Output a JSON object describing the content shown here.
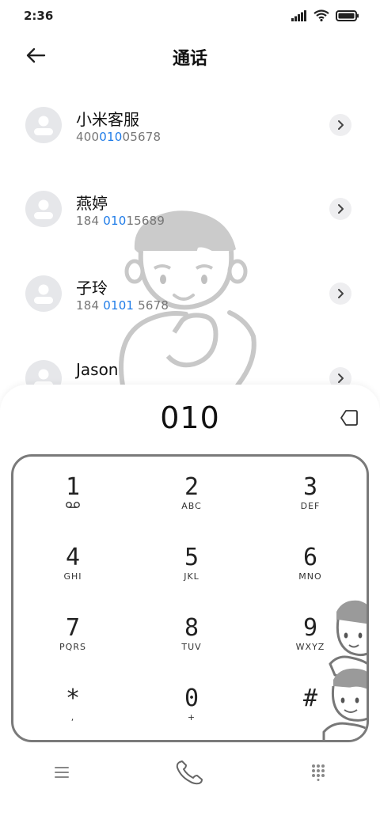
{
  "status_bar": {
    "time": "2:36"
  },
  "header": {
    "title": "通话"
  },
  "contacts": [
    {
      "name": "小米客服",
      "number_pre": "400",
      "number_hl": "010",
      "number_post": "05678"
    },
    {
      "name": "燕婷",
      "number_pre": "184 ",
      "number_hl": "010",
      "number_post": "15689"
    },
    {
      "name": "子玲",
      "number_pre": "184 ",
      "number_hl": "0101",
      "number_post": " 5678"
    },
    {
      "name": "Jason",
      "number_pre": "",
      "number_hl": "",
      "number_post": ""
    }
  ],
  "dialer": {
    "number": "010",
    "keys": [
      {
        "digit": "1",
        "letters": ""
      },
      {
        "digit": "2",
        "letters": "ABC"
      },
      {
        "digit": "3",
        "letters": "DEF"
      },
      {
        "digit": "4",
        "letters": "GHI"
      },
      {
        "digit": "5",
        "letters": "JKL"
      },
      {
        "digit": "6",
        "letters": "MNO"
      },
      {
        "digit": "7",
        "letters": "PQRS"
      },
      {
        "digit": "8",
        "letters": "TUV"
      },
      {
        "digit": "9",
        "letters": "WXYZ"
      },
      {
        "digit": "*",
        "letters": ","
      },
      {
        "digit": "0",
        "letters": "+"
      },
      {
        "digit": "#",
        "letters": ""
      }
    ]
  },
  "colors": {
    "highlight": "#1f7ce8",
    "avatar_bg": "#e6e7ea",
    "keypad_border": "#7a7a7a"
  },
  "icons": {
    "back": "arrow-left-icon",
    "chevron": "chevron-right-icon",
    "backspace": "backspace-icon",
    "voicemail": "voicemail-icon",
    "menu": "menu-icon",
    "call": "phone-icon",
    "dialpad": "dialpad-icon"
  }
}
